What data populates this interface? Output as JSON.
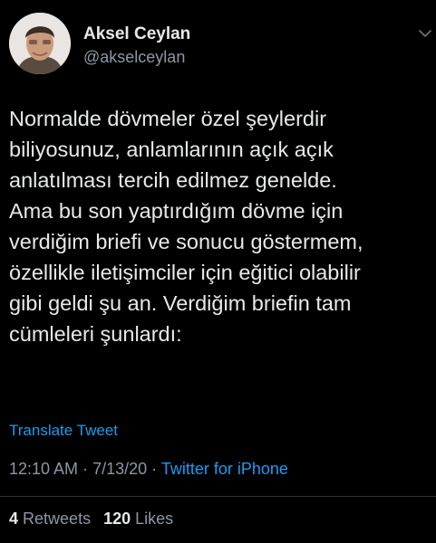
{
  "author": {
    "name": "Aksel Ceylan",
    "handle": "@akselceylan"
  },
  "tweet": {
    "text": "Normalde dövmeler özel şeylerdir\nbiliyosunuz, anlamlarının açık açık\nanlatılması tercih edilmez genelde.\nAma bu son yaptırdığım dövme için\nverdiğim briefi ve sonucu göstermem,\nözellikle iletişimciler için eğitici olabilir\ngibi geldi şu an. Verdiğim briefin tam\ncümleleri şunlardı:",
    "translate_label": "Translate Tweet",
    "time": "12:10 AM",
    "separator": "·",
    "date": "7/13/20",
    "source": "Twitter for iPhone"
  },
  "stats": {
    "retweets_count": "4",
    "retweets_label": "Retweets",
    "likes_count": "120",
    "likes_label": "Likes"
  },
  "icons": {
    "menu": "chevron-down-icon"
  },
  "colors": {
    "background": "#000000",
    "link": "#1d9bf0",
    "secondary_text": "#8b98a5",
    "primary_text": "#e7e9ea"
  }
}
